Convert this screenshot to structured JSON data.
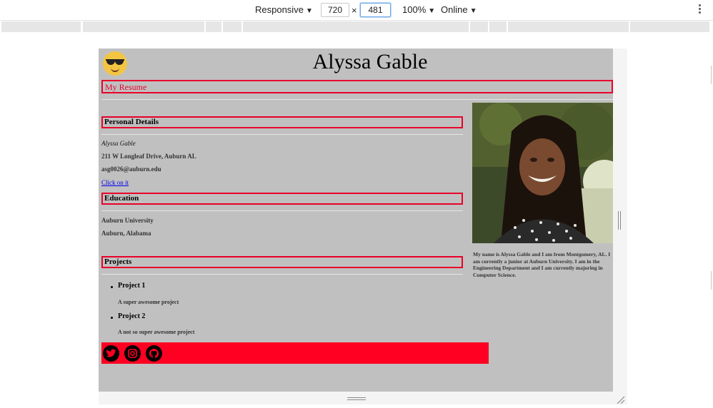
{
  "devtools": {
    "device": "Responsive",
    "width": "720",
    "height": "481",
    "zoom": "100%",
    "network": "Online",
    "dimension_separator": "×"
  },
  "page": {
    "title": "Alyssa Gable",
    "resume_label": "My Resume",
    "sections": {
      "personal": {
        "heading": "Personal Details",
        "name": "Alyssa Gable",
        "address": "211 W Longleaf Drive, Auburn AL",
        "email": "asg0026@auburn.edu",
        "link": "Click on it"
      },
      "education": {
        "heading": "Education",
        "school": "Auburn University",
        "location": "Auburn, Alabama"
      },
      "projects": {
        "heading": "Projects",
        "items": [
          {
            "title": "Project 1",
            "desc": "A super awesome project"
          },
          {
            "title": "Project 2",
            "desc": "A not so super awesome project"
          }
        ]
      }
    },
    "bio": "My name is Alyssa Gable and I am from Montgomery, AL. I am currently a junior at Auburn University. I am in the Engineering Department and I am currently majoring in Computer Science.",
    "social_icons": [
      "twitter-icon",
      "instagram-icon",
      "github-icon"
    ],
    "colors": {
      "accent": "#e8002a",
      "footer": "#ff0022",
      "page_bg": "#c0c0c0"
    }
  }
}
